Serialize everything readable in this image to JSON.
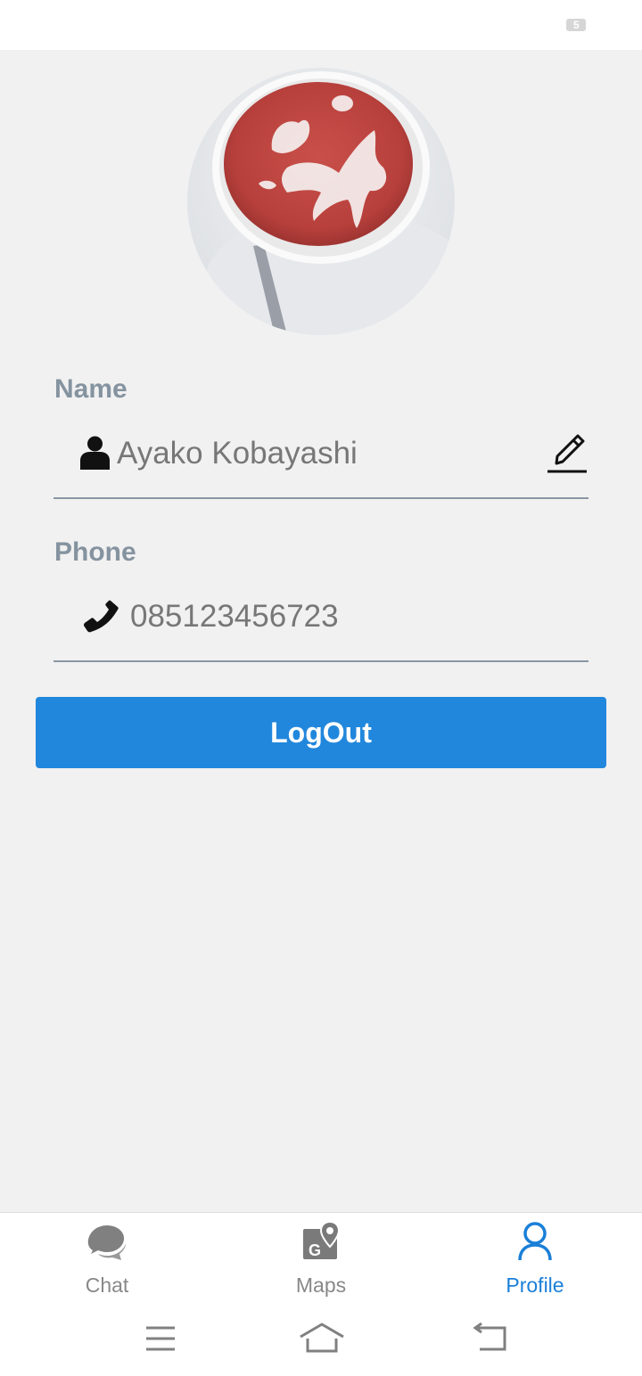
{
  "status_bar": {
    "battery_text": "5"
  },
  "profile": {
    "avatar_icon": "latte-art-photo",
    "name_label": "Name",
    "name_value": "Ayako Kobayashi",
    "phone_label": "Phone",
    "phone_value": "085123456723",
    "logout_label": "LogOut"
  },
  "bottom_nav": {
    "items": [
      {
        "label": "Chat",
        "icon": "chat-bubbles-icon",
        "active": false
      },
      {
        "label": "Maps",
        "icon": "map-pin-icon",
        "active": false
      },
      {
        "label": "Profile",
        "icon": "user-icon",
        "active": true
      }
    ]
  },
  "colors": {
    "accent": "#2187dc",
    "active_tab": "#1a7fd8",
    "label": "#8593a0",
    "background": "#f1f1f1"
  }
}
